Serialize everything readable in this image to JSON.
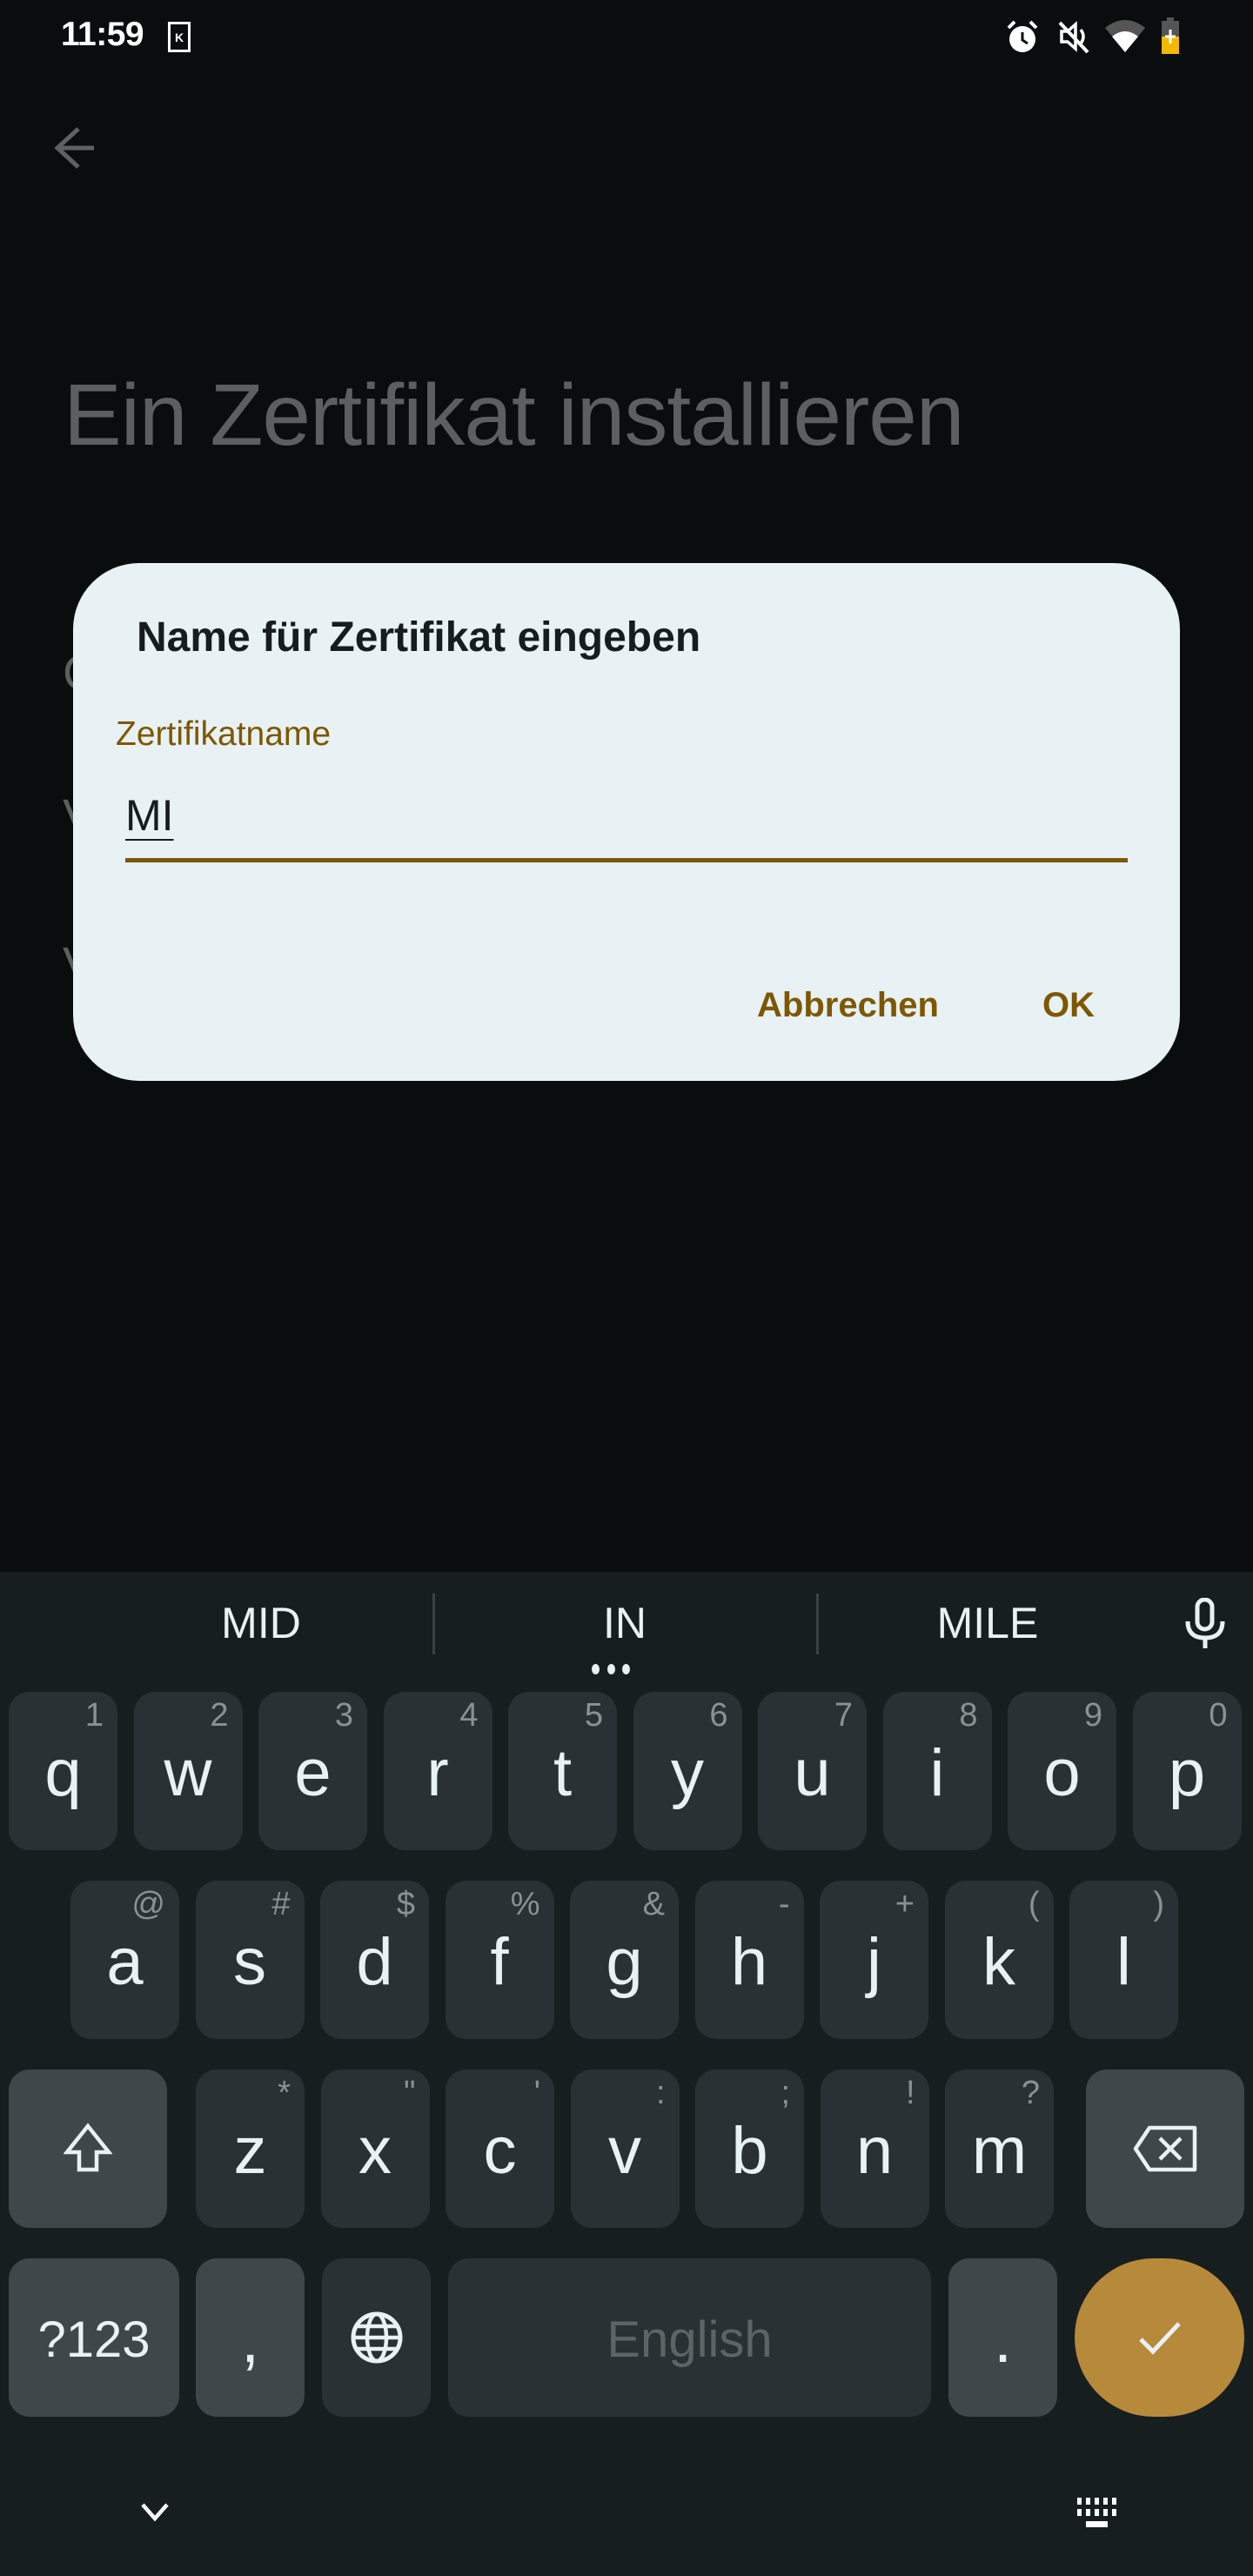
{
  "status_bar": {
    "time": "11:59",
    "notification_letter": "K",
    "icons": [
      "alarm-icon",
      "volume-muted-icon",
      "wifi-icon",
      "battery-charging-icon"
    ],
    "battery_color": "#f5b800"
  },
  "background_page": {
    "title": "Ein Zertifikat installieren",
    "partial_lines": [
      "C",
      "V",
      "V"
    ]
  },
  "dialog": {
    "title": "Name für Zertifikat eingeben",
    "field_label": "Zertifikatname",
    "field_value": "MI",
    "cancel_label": "Abbrechen",
    "ok_label": "OK",
    "accent_color": "#7d5700",
    "surface_color": "#e8f1f4"
  },
  "keyboard": {
    "suggestions": [
      "MID",
      "IN",
      "MILE"
    ],
    "row1": [
      {
        "key": "q",
        "hint": "1"
      },
      {
        "key": "w",
        "hint": "2"
      },
      {
        "key": "e",
        "hint": "3"
      },
      {
        "key": "r",
        "hint": "4"
      },
      {
        "key": "t",
        "hint": "5"
      },
      {
        "key": "y",
        "hint": "6"
      },
      {
        "key": "u",
        "hint": "7"
      },
      {
        "key": "i",
        "hint": "8"
      },
      {
        "key": "o",
        "hint": "9"
      },
      {
        "key": "p",
        "hint": "0"
      }
    ],
    "row2": [
      {
        "key": "a",
        "hint": "@"
      },
      {
        "key": "s",
        "hint": "#"
      },
      {
        "key": "d",
        "hint": "$"
      },
      {
        "key": "f",
        "hint": "%"
      },
      {
        "key": "g",
        "hint": "&"
      },
      {
        "key": "h",
        "hint": "-"
      },
      {
        "key": "j",
        "hint": "+"
      },
      {
        "key": "k",
        "hint": "("
      },
      {
        "key": "l",
        "hint": ")"
      }
    ],
    "row3": [
      {
        "key": "z",
        "hint": "*"
      },
      {
        "key": "x",
        "hint": "\""
      },
      {
        "key": "c",
        "hint": "'"
      },
      {
        "key": "v",
        "hint": ":"
      },
      {
        "key": "b",
        "hint": ";"
      },
      {
        "key": "n",
        "hint": "!"
      },
      {
        "key": "m",
        "hint": "?"
      }
    ],
    "symbols_label": "?123",
    "comma_label": ",",
    "space_label": "English",
    "period_label": ".",
    "enter_color": "#b7893a"
  }
}
